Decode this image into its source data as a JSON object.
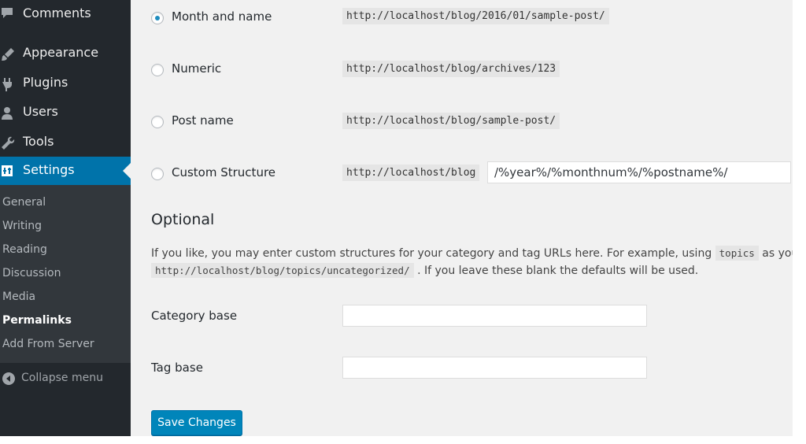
{
  "sidebar": {
    "items": [
      {
        "label": "Comments",
        "icon": "comment-icon"
      },
      {
        "label": "Appearance",
        "icon": "brush-icon"
      },
      {
        "label": "Plugins",
        "icon": "plug-icon"
      },
      {
        "label": "Users",
        "icon": "user-icon"
      },
      {
        "label": "Tools",
        "icon": "wrench-icon"
      },
      {
        "label": "Settings",
        "icon": "settings-icon",
        "active": true
      }
    ],
    "submenu": [
      "General",
      "Writing",
      "Reading",
      "Discussion",
      "Media",
      "Permalinks",
      "Add From Server"
    ],
    "current_submenu": "Permalinks",
    "collapse_label": "Collapse menu"
  },
  "permalink_options": [
    {
      "label": "Month and name",
      "example": "http://localhost/blog/2016/01/sample-post/",
      "checked": true
    },
    {
      "label": "Numeric",
      "example": "http://localhost/blog/archives/123",
      "checked": false
    },
    {
      "label": "Post name",
      "example": "http://localhost/blog/sample-post/",
      "checked": false
    },
    {
      "label": "Custom Structure",
      "example": "http://localhost/blog",
      "value": "/%year%/%monthnum%/%postname%/",
      "checked": false
    }
  ],
  "optional": {
    "heading": "Optional",
    "desc_part1": "If you like, you may enter custom structures for your category and tag URLs here. For example, using",
    "desc_code1": "topics",
    "desc_part2": "as your cate",
    "desc_code2": "http://localhost/blog/topics/uncategorized/",
    "desc_part3": ". If you leave these blank the defaults will be used."
  },
  "fields": {
    "category_label": "Category base",
    "category_value": "",
    "tag_label": "Tag base",
    "tag_value": ""
  },
  "save_label": "Save Changes",
  "colors": {
    "sidebar": "#23282d",
    "active": "#0073aa",
    "content_bg": "#f1f1f1",
    "button": "#0085ba"
  }
}
